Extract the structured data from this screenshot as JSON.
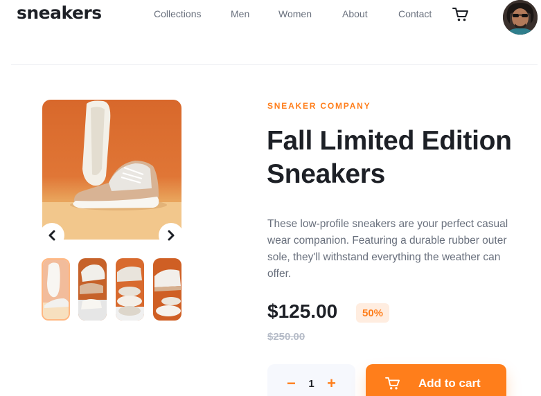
{
  "header": {
    "logo": "sneakers",
    "nav": [
      {
        "label": "Collections"
      },
      {
        "label": "Men"
      },
      {
        "label": "Women"
      },
      {
        "label": "About"
      },
      {
        "label": "Contact"
      }
    ],
    "cart_icon": "cart-icon",
    "avatar_icon": "avatar"
  },
  "gallery": {
    "prev_icon": "chevron-left-icon",
    "next_icon": "chevron-right-icon",
    "thumbnail_count": 4,
    "active_thumbnail": 1
  },
  "product": {
    "company": "SNEAKER COMPANY",
    "title": "Fall Limited Edition Sneakers",
    "description": "These low-profile sneakers are your perfect casual wear companion. Featuring a durable rubber outer sole, they'll withstand everything the weather can offer.",
    "price": "$125.00",
    "discount": "50%",
    "original_price": "$250.00"
  },
  "cart_controls": {
    "minus": "−",
    "quantity": "1",
    "plus": "+",
    "add_label": "Add to cart"
  },
  "colors": {
    "accent": "#ff7e1b",
    "accent_pale": "#ffede0",
    "dark": "#1d2026",
    "muted": "#69707d",
    "light_gray": "#b6bcc8",
    "input_bg": "#f6f8fd"
  }
}
